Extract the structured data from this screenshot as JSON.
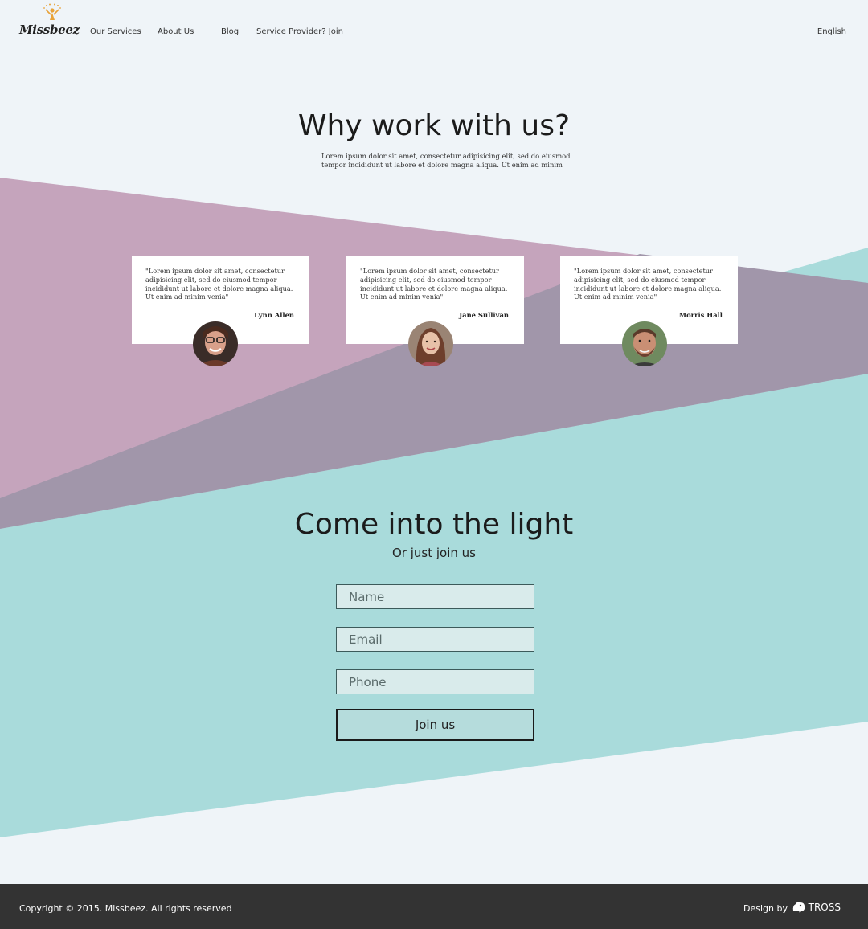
{
  "brand": {
    "logo_text": "Missbeez",
    "accent": "#e8a33a"
  },
  "nav": {
    "items": [
      "Our Services",
      "About Us",
      "Blog",
      "Service Provider? Join"
    ],
    "language": "English"
  },
  "why": {
    "title": "Why work with us?",
    "subtitle": "Lorem ipsum dolor sit amet, consectetur adipisicing elit, sed do eiusmod tempor incididunt ut labore et dolore magna aliqua. Ut enim ad minim"
  },
  "testimonials": [
    {
      "quote": "\"Lorem ipsum dolor sit amet, consectetur adipisicing elit, sed do eiusmod tempor incididunt ut labore et dolore magna aliqua. Ut enim ad minim venia\"",
      "author": "Lynn Allen"
    },
    {
      "quote": "\"Lorem ipsum dolor sit amet, consectetur adipisicing elit, sed do eiusmod tempor incididunt ut labore et dolore magna aliqua. Ut enim ad minim venia\"",
      "author": "Jane Sullivan"
    },
    {
      "quote": "\"Lorem ipsum dolor sit amet, consectetur adipisicing elit, sed do eiusmod tempor incididunt ut labore et dolore magna aliqua. Ut enim ad minim venia\"",
      "author": "Morris Hall"
    }
  ],
  "join": {
    "title": "Come into the light",
    "subtitle": "Or just join us",
    "name_placeholder": "Name",
    "email_placeholder": "Email",
    "phone_placeholder": "Phone",
    "button": "Join us"
  },
  "footer": {
    "copyright": "Copyright © 2015. Missbeez. All rights reserved",
    "design_by": "Design by",
    "designer": "TROSS"
  },
  "colors": {
    "background": "#eff4f8",
    "pink_band": "#c5a4bc",
    "teal_band": "#a9dbdb",
    "overlap": "#a196aa",
    "footer": "#333333"
  }
}
